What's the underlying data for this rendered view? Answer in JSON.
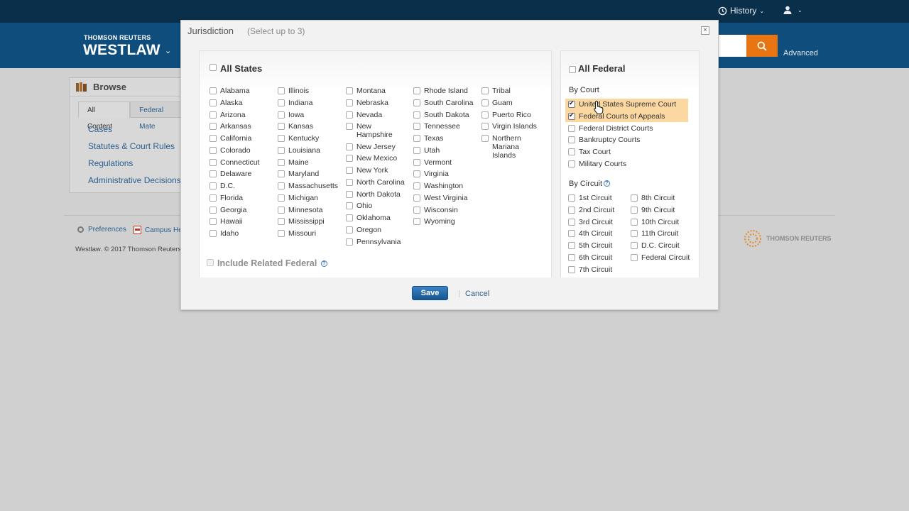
{
  "topbar": {
    "history_label": "History",
    "history_icon": "history-icon",
    "user_icon": "user-icon"
  },
  "header": {
    "brand_small": "THOMSON REUTERS",
    "brand_big": "WESTLAW",
    "search_icon": "search-icon",
    "advanced_label": "Advanced",
    "accent_color": "#e87511"
  },
  "browse": {
    "title": "Browse",
    "tabs": [
      "All Content",
      "Federal Mate"
    ],
    "links": [
      "Cases",
      "Statutes & Court Rules",
      "Regulations",
      "Administrative Decisions"
    ]
  },
  "footer": {
    "preferences": "Preferences",
    "campus": "Campus He",
    "copyright": "Westlaw. © 2017 Thomson Reuters",
    "logo": "THOMSON REUTERS"
  },
  "modal": {
    "title": "Jurisdiction",
    "subtitle": "(Select up to 3)",
    "close_icon": "close-icon",
    "all_states_label": "All States",
    "states_columns": [
      [
        "Alabama",
        "Alaska",
        "Arizona",
        "Arkansas",
        "California",
        "Colorado",
        "Connecticut",
        "Delaware",
        "D.C.",
        "Florida",
        "Georgia",
        "Hawaii",
        "Idaho"
      ],
      [
        "Illinois",
        "Indiana",
        "Iowa",
        "Kansas",
        "Kentucky",
        "Louisiana",
        "Maine",
        "Maryland",
        "Massachusetts",
        "Michigan",
        "Minnesota",
        "Mississippi",
        "Missouri"
      ],
      [
        "Montana",
        "Nebraska",
        "Nevada",
        "New Hampshire",
        "New Jersey",
        "New Mexico",
        "New York",
        "North Carolina",
        "North Dakota",
        "Ohio",
        "Oklahoma",
        "Oregon",
        "Pennsylvania"
      ],
      [
        "Rhode Island",
        "South Carolina",
        "South Dakota",
        "Tennessee",
        "Texas",
        "Utah",
        "Vermont",
        "Virginia",
        "Washington",
        "West Virginia",
        "Wisconsin",
        "Wyoming"
      ],
      [
        "Tribal",
        "Guam",
        "Puerto Rico",
        "Virgin Islands",
        "Northern Mariana Islands"
      ]
    ],
    "include_related_label": "Include Related Federal",
    "all_federal_label": "All Federal",
    "by_court_label": "By Court",
    "courts": [
      {
        "label": "United States Supreme Court",
        "checked": true
      },
      {
        "label": "Federal Courts of Appeals",
        "checked": true
      },
      {
        "label": "Federal District Courts",
        "checked": false
      },
      {
        "label": "Bankruptcy Courts",
        "checked": false
      },
      {
        "label": "Tax Court",
        "checked": false
      },
      {
        "label": "Military Courts",
        "checked": false
      }
    ],
    "by_circuit_label": "By Circuit",
    "circuits_left": [
      "1st Circuit",
      "2nd Circuit",
      "3rd Circuit",
      "4th Circuit",
      "5th Circuit",
      "6th Circuit",
      "7th Circuit"
    ],
    "circuits_right": [
      "8th Circuit",
      "9th Circuit",
      "10th Circuit",
      "11th Circuit",
      "D.C. Circuit",
      "Federal Circuit"
    ],
    "save_label": "Save",
    "cancel_label": "Cancel",
    "highlight_color": "#fbd7a1"
  }
}
